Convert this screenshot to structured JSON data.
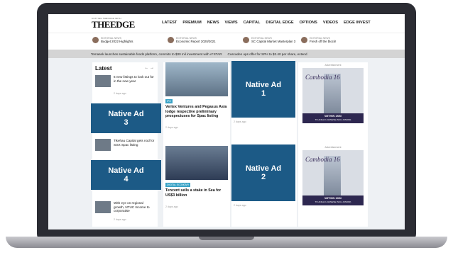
{
  "site": {
    "tagline": "CUTTING THROUGH WITH",
    "logo": "THEEDGE"
  },
  "nav": [
    "LATEST",
    "PREMIUM",
    "NEWS",
    "VIEWS",
    "CAPITAL",
    "DIGITAL EDGE",
    "OPTIONS",
    "VIDEOS",
    "EDGE INVEST"
  ],
  "editorial": [
    {
      "kicker": "EDITORIAL NEWS",
      "headline": "Budget 2022 Highlights"
    },
    {
      "kicker": "EDITORIAL NEWS",
      "headline": "Economic Report 2020/2021"
    },
    {
      "kicker": "EDITORIAL NEWS",
      "headline": "SC Capital Market Masterplan 3"
    },
    {
      "kicker": "EDITORIAL NEWS",
      "headline": "Fresh off the block!"
    }
  ],
  "ticker": [
    "Temasek launches sustainable foods platform, commits to $30 mil investment with A*STAR",
    "Cuscaden ups offer for SPH to $2.40 per share, extend"
  ],
  "latest": {
    "title": "Latest",
    "arrows": "← →",
    "items": [
      {
        "text": "6 new listings to look out for in the new year",
        "date": "2 days ago"
      },
      {
        "text": "Tikehau Capital gets nod for SGX Spac listing",
        "date": "2 days ago"
      },
      {
        "text": "With eye on regional growth, NTUC Income to corporatise",
        "date": "2 days ago"
      }
    ]
  },
  "articles": [
    {
      "badge": "IPO",
      "title": "Vertex Ventures and Pegasus Asia lodge respective preliminary prospectuses for Spac listing",
      "date": "2 days ago"
    },
    {
      "badge": "DIGITAL ECONOMY",
      "title": "Tencent sells a stake in Sea for US$3 billion",
      "date": "2 days ago"
    }
  ],
  "right_dates": [
    "2 days ago",
    "2 days ago"
  ],
  "ads": {
    "label": "Advertisement",
    "brand": "Cambodia 16",
    "line1": "WITHIN 1KM",
    "line2": "TO ANGLO-CHINESE (SCH JUNIOR)"
  },
  "native_ads": [
    {
      "line1": "Native Ad",
      "line2": "1"
    },
    {
      "line1": "Native Ad",
      "line2": "2"
    },
    {
      "line1": "Native Ad",
      "line2": "3"
    },
    {
      "line1": "Native Ad",
      "line2": "4"
    }
  ],
  "colors": {
    "native_ad_bg": "#1c5a86",
    "badge": "#3aa3c6",
    "ticker_bg": "#d4d4d4",
    "laptop": "#2b2c33"
  }
}
